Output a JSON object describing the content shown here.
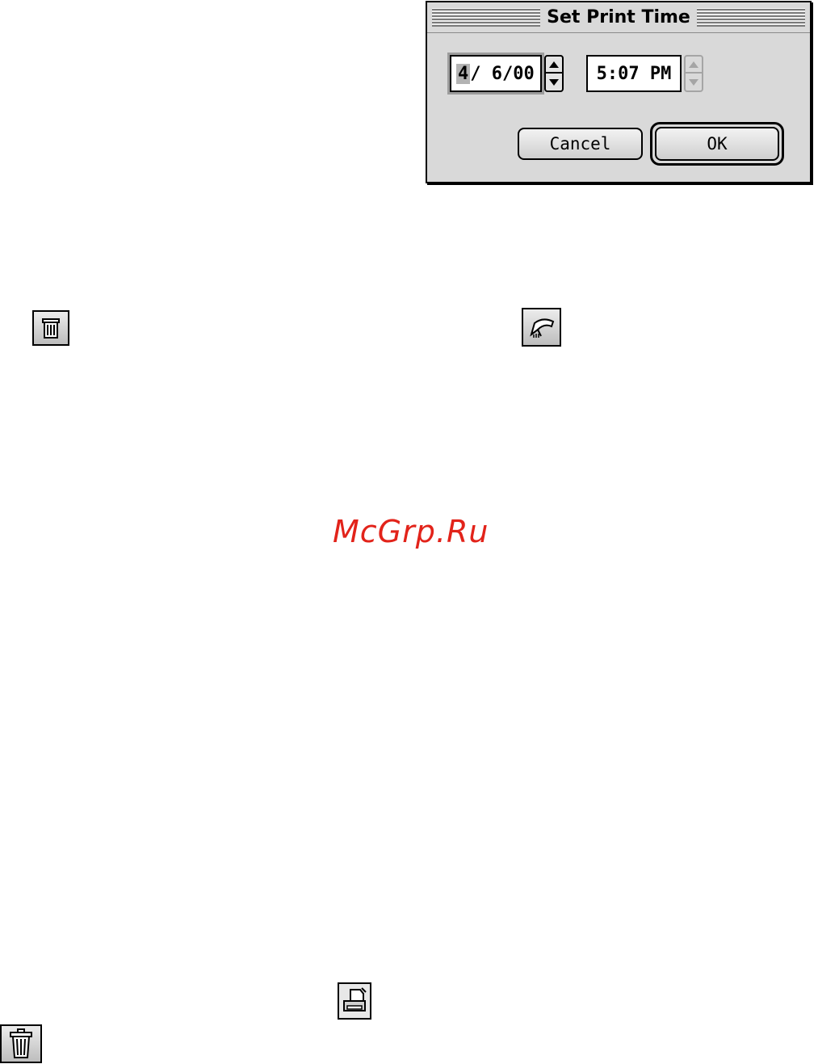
{
  "dialog": {
    "title": "Set Print Time",
    "date": {
      "month": "4",
      "rest": "/ 6/00"
    },
    "time": {
      "value": "5:07  PM"
    },
    "buttons": {
      "cancel": "Cancel",
      "ok": "OK"
    }
  },
  "watermark": "McGrp.Ru",
  "icons": {
    "trash_small": "trash-icon",
    "fan": "paper-fan-icon",
    "printer": "printer-icon",
    "trash_large": "trash-icon"
  },
  "colors": {
    "dialog_background": "#d9d9d9",
    "watermark": "#e2231a"
  }
}
